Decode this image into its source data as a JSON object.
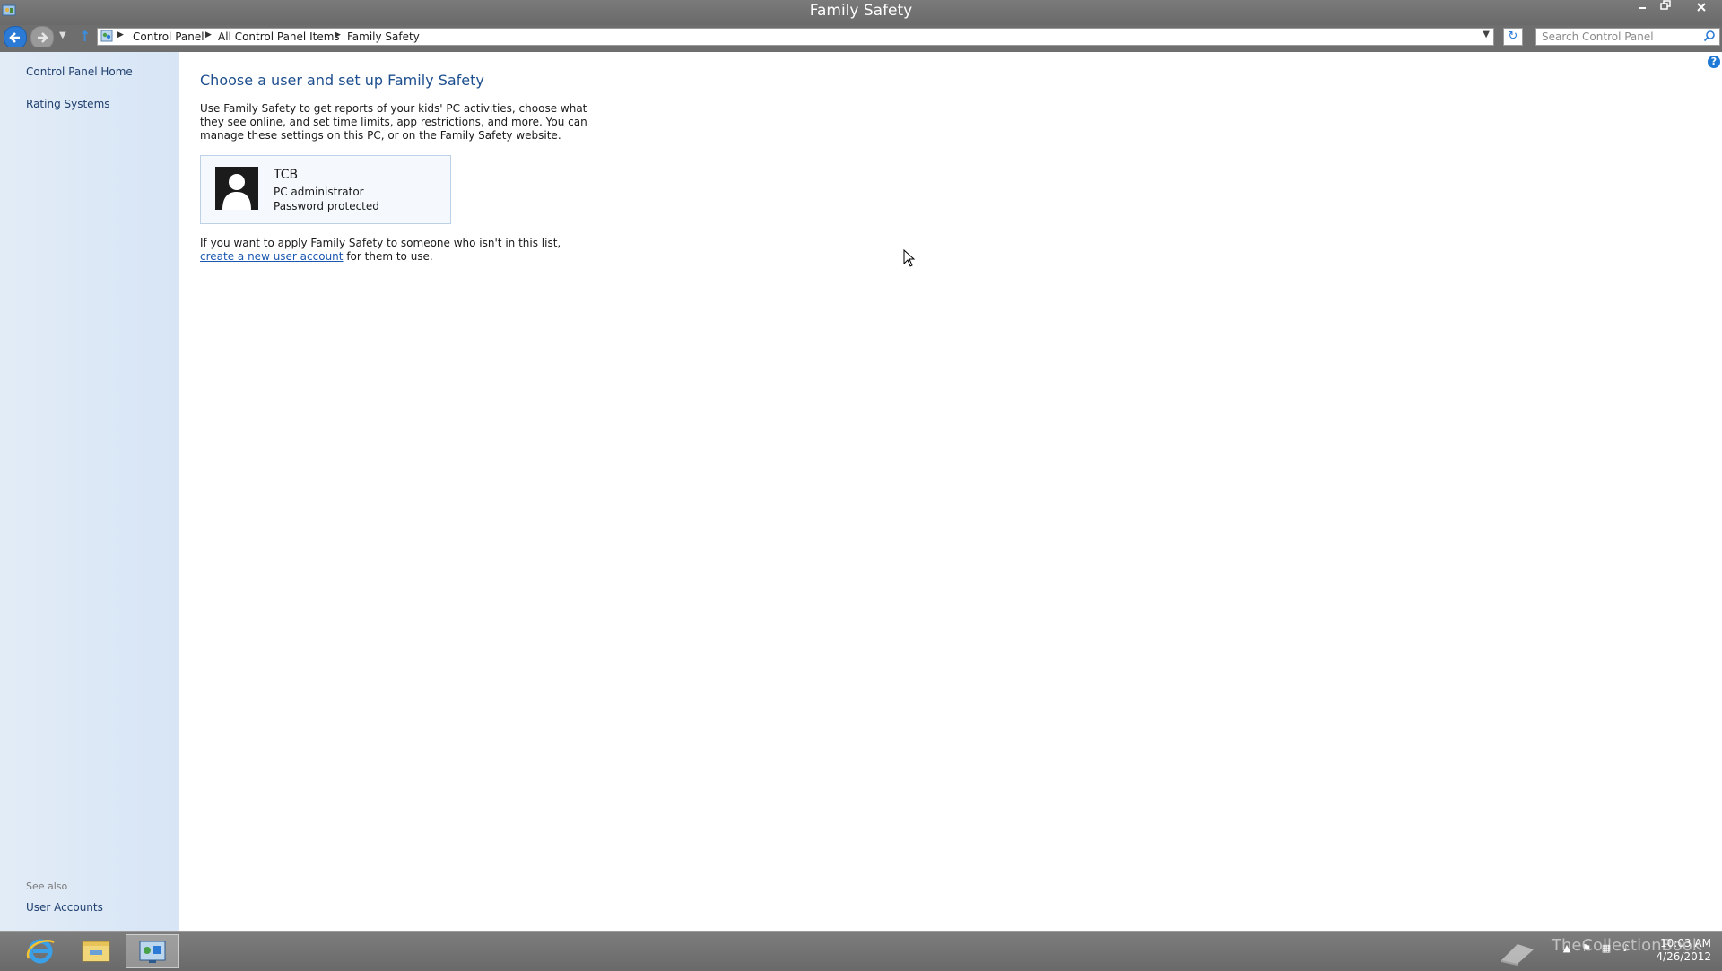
{
  "window": {
    "title": "Family Safety",
    "controls": {
      "minimize_icon": "minimize-icon",
      "maximize_icon": "restore-icon",
      "close_icon": "close-icon"
    }
  },
  "nav": {
    "breadcrumbs": [
      "Control Panel",
      "All Control Panel Items",
      "Family Safety"
    ],
    "search_placeholder": "Search Control Panel"
  },
  "sidebar": {
    "items": [
      {
        "label": "Control Panel Home"
      },
      {
        "label": "Rating Systems"
      }
    ],
    "see_also_label": "See also",
    "see_also_items": [
      {
        "label": "User Accounts"
      }
    ]
  },
  "main": {
    "heading": "Choose a user and set up Family Safety",
    "intro": "Use Family Safety to get reports of your kids' PC activities, choose what they see online, and set time limits, app restrictions, and more. You can manage these settings on this PC, or on the Family Safety website.",
    "user": {
      "name": "TCB",
      "role": "PC administrator",
      "status": "Password protected"
    },
    "footnote_before": "If you want to apply Family Safety to someone who isn't in this list, ",
    "footnote_link": "create a new user account",
    "footnote_after": " for them to use."
  },
  "taskbar": {
    "apps": [
      "internet-explorer-icon",
      "file-explorer-icon",
      "control-panel-icon"
    ],
    "watermark": "TheCollectionBook",
    "time": "10:03 AM",
    "date": "4/26/2012"
  },
  "colors": {
    "accent": "#2a7ad6",
    "heading": "#1e4f8e",
    "link": "#1a57b0",
    "sidebar_bg": "#dde9f6",
    "chrome": "#6e6e6e"
  }
}
